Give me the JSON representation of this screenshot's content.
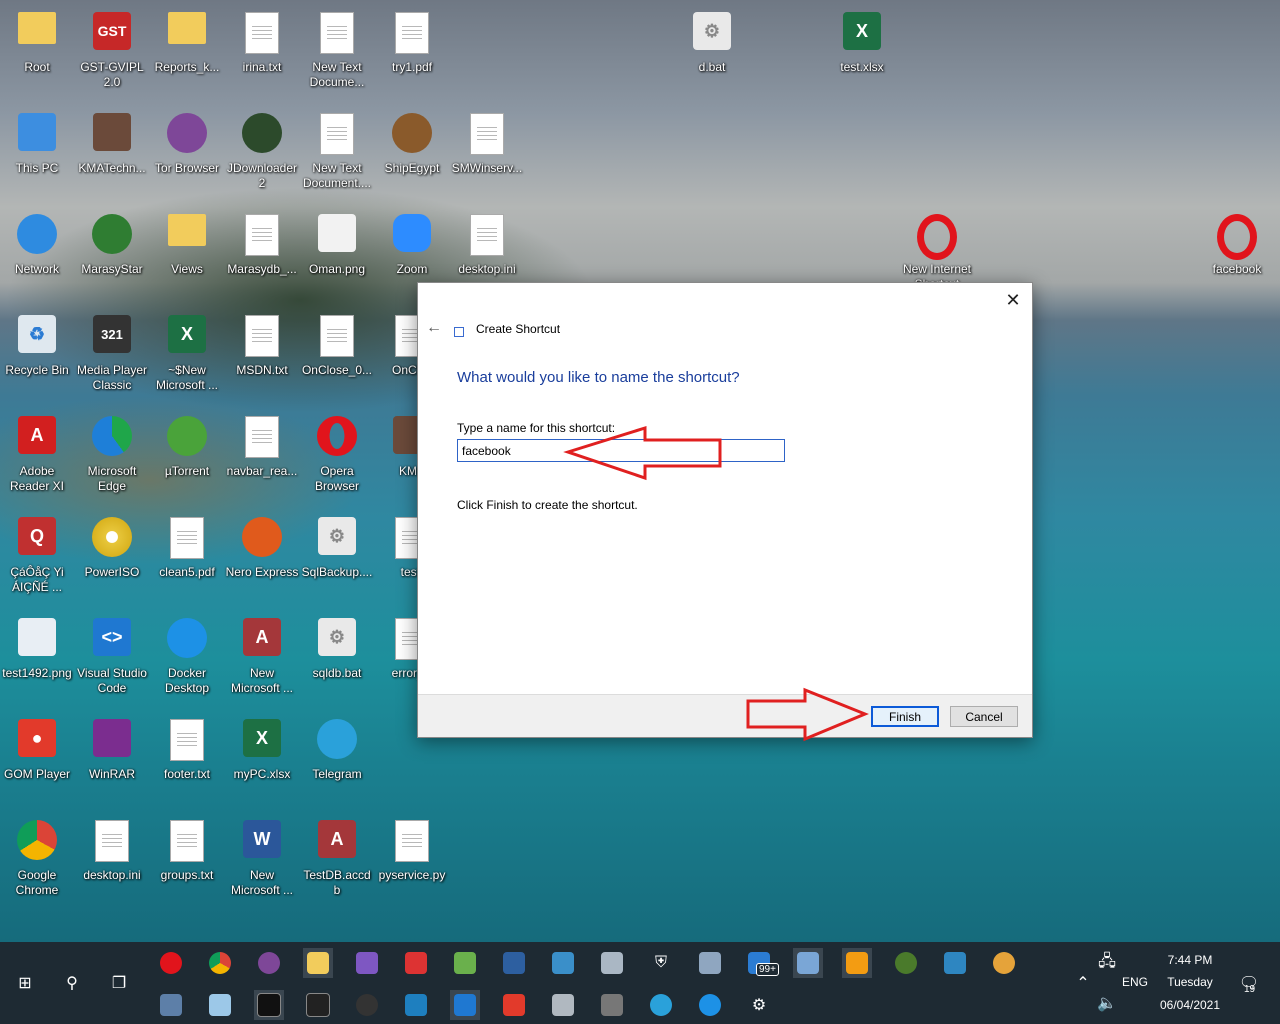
{
  "desktop_icons": {
    "root": "Root",
    "gst": "GST-GVIPL 2.0",
    "reports": "Reports_k...",
    "irina": "irina.txt",
    "newtext1": "New Text Docume...",
    "try1": "try1.pdf",
    "dbat": "d.bat",
    "testxlsx": "test.xlsx",
    "thispc": "This PC",
    "kma": "KMATechn...",
    "tor": "Tor Browser",
    "jdown": "JDownloader 2",
    "newtext2": "New Text Document....",
    "shipegypt": "ShipEgypt",
    "smwinserv": "SMWinserv...",
    "network": "Network",
    "marasystar": "MarasyStar",
    "views": "Views",
    "marasydb": "Marasydb_...",
    "oman": "Oman.png",
    "zoom": "Zoom",
    "desktopini1": "desktop.ini",
    "newinternet": "New Internet Shortcut",
    "facebook": "facebook",
    "recycle": "Recycle Bin",
    "mpc": "Media Player Classic",
    "snew": "~$New Microsoft ...",
    "msdn": "MSDN.txt",
    "onclose": "OnClose_0...",
    "onclos2": "OnClos",
    "adobe": "Adobe Reader XI",
    "edge": "Microsoft Edge",
    "utorrent": "µTorrent",
    "navbar": "navbar_rea...",
    "opera": "Opera Browser",
    "kma2": "KMA",
    "cao": "ÇáÔåÇ Yi ÁIÇÑÉ ...",
    "poweriso": "PowerISO",
    "clean5": "clean5.pdf",
    "nero": "Nero Express",
    "sqlbackup": "SqlBackup....",
    "test2": "test.",
    "test1492": "test1492.png",
    "vscode": "Visual Studio Code",
    "docker": "Docker Desktop",
    "newms": "New Microsoft ...",
    "sqldb": "sqldb.bat",
    "errorjs": "error_js",
    "gom": "GOM Player",
    "winrar": "WinRAR",
    "footer": "footer.txt",
    "mypc": "myPC.xlsx",
    "telegram": "Telegram",
    "chrome": "Google Chrome",
    "desktopini2": "desktop.ini",
    "groups": "groups.txt",
    "newword": "New Microsoft ...",
    "testdb": "TestDB.accdb",
    "pyservice": "pyservice.py"
  },
  "dialog": {
    "title": "Create Shortcut",
    "heading": "What would you like to name the shortcut?",
    "prompt": "Type a name for this shortcut:",
    "name_value": "facebook",
    "info": "Click Finish to create the shortcut.",
    "finish_label": "Finish",
    "cancel_label": "Cancel",
    "close_glyph": "✕",
    "back_glyph": "←"
  },
  "tray": {
    "time": "7:44 PM",
    "day": "Tuesday",
    "date": "06/04/2021",
    "lang": "ENG",
    "mail_badge": "99+",
    "notify_badge": "19"
  },
  "colors": {
    "accent": "#0c5ad8",
    "heading": "#1a3e9c",
    "taskbar": "#1e2a33",
    "annotation_arrow": "#e02020"
  }
}
